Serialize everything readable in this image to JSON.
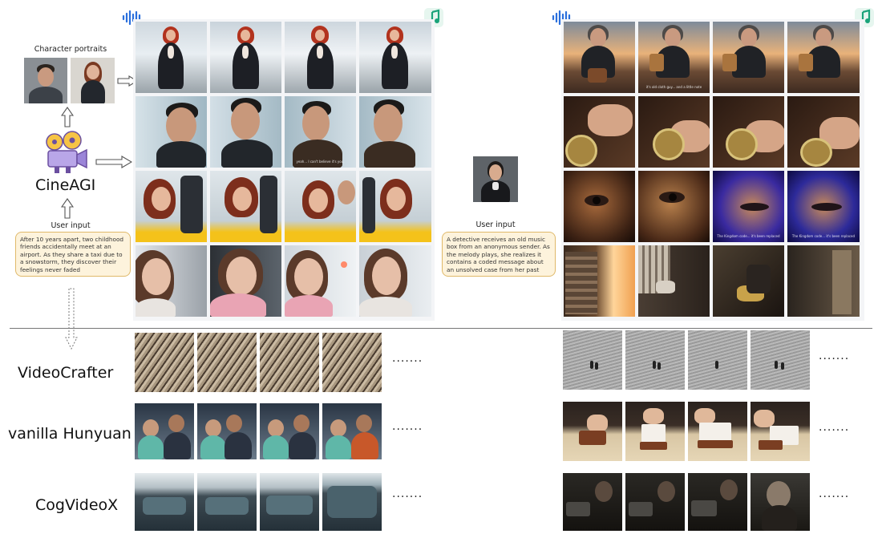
{
  "left": {
    "portraits_label": "Character portraits",
    "system_name": "CineAGI",
    "user_input_label": "User input",
    "prompt": "After 10 years apart, two childhood friends accidentally meet at an airport. As they share a taxi due to a snowstorm, they discover their feelings never faded"
  },
  "right": {
    "user_input_label": "User input",
    "prompt": "A detective receives an old music box from an anonymous sender. As the melody plays, she realizes it contains a coded message about an unsolved case from her past"
  },
  "baselines": {
    "videocrafter": "VideoCrafter",
    "hunyuan": "vanilla Hunyuan",
    "cogvideox": "CogVideoX",
    "ellipsis": "·······"
  },
  "subtitles": {
    "left_row2_col3": "yeah... I can't believe it's you.",
    "right_row1_col2": "it's old cloth guy... and a little note",
    "right_row3_col3": "The Kingdom code... it's been replaced",
    "right_row3_col4": "The Kingdom code... it's been replaced"
  },
  "colors": {
    "audio_icon": "#2a6fdc",
    "music_icon": "#1aa37a",
    "speech_bg": "#fdf3dc",
    "speech_border": "#e0b96a",
    "divider": "#777777"
  },
  "icons": [
    "audio-wave-icon",
    "music-note-icon",
    "film-camera-icon",
    "arrow-up-icon",
    "arrow-right-icon",
    "dotted-arrow-down-icon"
  ]
}
